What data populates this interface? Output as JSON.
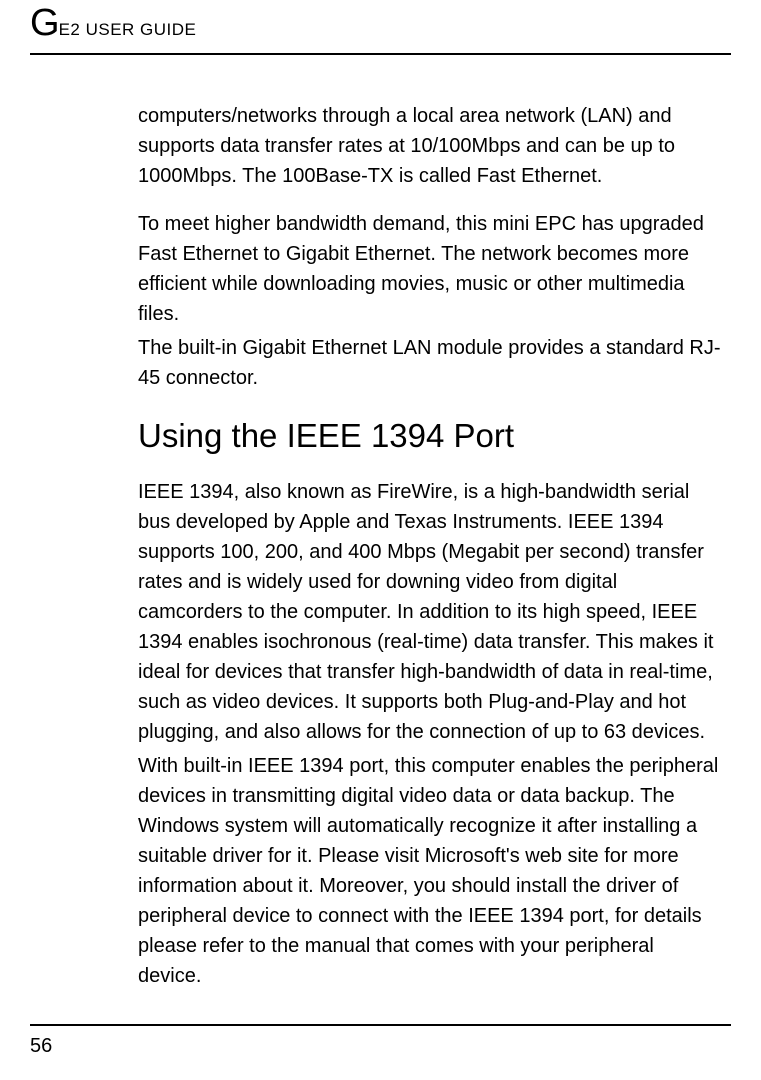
{
  "header": {
    "prefix": "G",
    "title": "E2 USER GUIDE"
  },
  "content": {
    "para1": "computers/networks through a local area network (LAN) and supports data transfer rates at 10/100Mbps and can be up to 1000Mbps. The 100Base-TX is called Fast Ethernet.",
    "para2": "To meet higher bandwidth demand, this mini EPC has upgraded Fast Ethernet to Gigabit Ethernet. The network becomes more efficient while downloading movies, music or other multimedia files.",
    "para3": "The built-in Gigabit Ethernet LAN module provides a standard RJ-45 connector.",
    "heading1": "Using the IEEE 1394 Port",
    "para4": "IEEE 1394, also known as FireWire, is a high-bandwidth serial bus developed by Apple and Texas Instruments. IEEE 1394 supports 100, 200, and 400 Mbps (Megabit per second) transfer rates and is widely used for downing video from digital camcorders to the computer. In addition to its high speed, IEEE 1394 enables isochronous (real-time) data transfer. This makes it ideal for devices that transfer high-bandwidth of data in real-time, such as video devices. It supports both Plug-and-Play and hot plugging, and also allows for the connection of up to 63 devices.",
    "para5": "With built-in IEEE 1394 port, this computer enables the peripheral devices in transmitting digital video data or data backup. The Windows system will automatically recognize it after installing a suitable driver for it. Please visit Microsoft's web site for more information about it. Moreover, you should install the driver of peripheral device to connect with the IEEE 1394 port, for details please refer to the manual that comes with your peripheral device."
  },
  "footer": {
    "pageNumber": "56"
  }
}
